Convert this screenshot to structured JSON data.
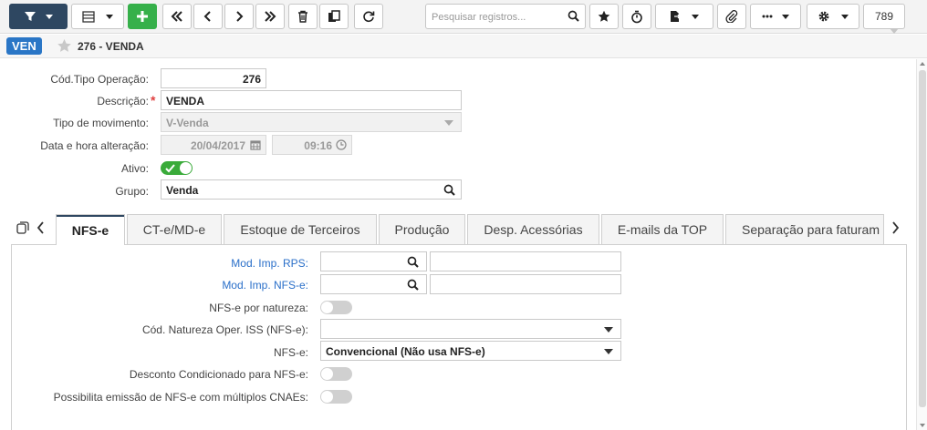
{
  "toolbar": {
    "search_placeholder": "Pesquisar registros...",
    "record_count": "789",
    "accent_dark": "#2e4761",
    "accent_green": "#36b04a",
    "icons": [
      "filter-icon",
      "grid-icon",
      "plus-icon",
      "first-icon",
      "prev-icon",
      "next-icon",
      "last-icon",
      "trash-icon",
      "copy-icon",
      "refresh-icon",
      "search-icon",
      "star-icon",
      "timer-icon",
      "file-export-icon",
      "paperclip-icon",
      "more-icon",
      "gear-icon"
    ]
  },
  "header": {
    "badge": "VEN",
    "title": "276 - VENDA",
    "badge_color": "#2a76c6"
  },
  "form": {
    "cod_tipo_operacao": {
      "label": "Cód.Tipo Operação:",
      "value": "276"
    },
    "descricao": {
      "label": "Descrição:",
      "required_mark": "*",
      "value": "VENDA"
    },
    "tipo_movimento": {
      "label": "Tipo de movimento:",
      "value": "V-Venda"
    },
    "data_hora": {
      "label": "Data e hora alteração:",
      "date": "20/04/2017",
      "time": "09:16"
    },
    "ativo": {
      "label": "Ativo:",
      "value": true
    },
    "grupo": {
      "label": "Grupo:",
      "value": "Venda"
    }
  },
  "tabs": [
    {
      "label": "NFS-e",
      "active": true
    },
    {
      "label": "CT-e/MD-e"
    },
    {
      "label": "Estoque de Terceiros"
    },
    {
      "label": "Produção"
    },
    {
      "label": "Desp. Acessórias"
    },
    {
      "label": "E-mails da TOP"
    },
    {
      "label": "Separação para faturam"
    }
  ],
  "nfse": {
    "mod_imp_rps": {
      "label": "Mod. Imp. RPS:",
      "value": "",
      "desc": ""
    },
    "mod_imp_nfse": {
      "label": "Mod. Imp. NFS-e:",
      "value": "",
      "desc": ""
    },
    "nfse_por_natureza": {
      "label": "NFS-e por natureza:",
      "value": false
    },
    "cod_natureza_iss": {
      "label": "Cód. Natureza Oper. ISS (NFS-e):",
      "value": ""
    },
    "nfse_tipo": {
      "label": "NFS-e:",
      "value": "Convencional (Não usa NFS-e)"
    },
    "desconto_condicionado": {
      "label": "Desconto Condicionado para NFS-e:",
      "value": false
    },
    "multiplos_cnaes": {
      "label": "Possibilita emissão de NFS-e com múltiplos CNAEs:",
      "value": false
    }
  }
}
